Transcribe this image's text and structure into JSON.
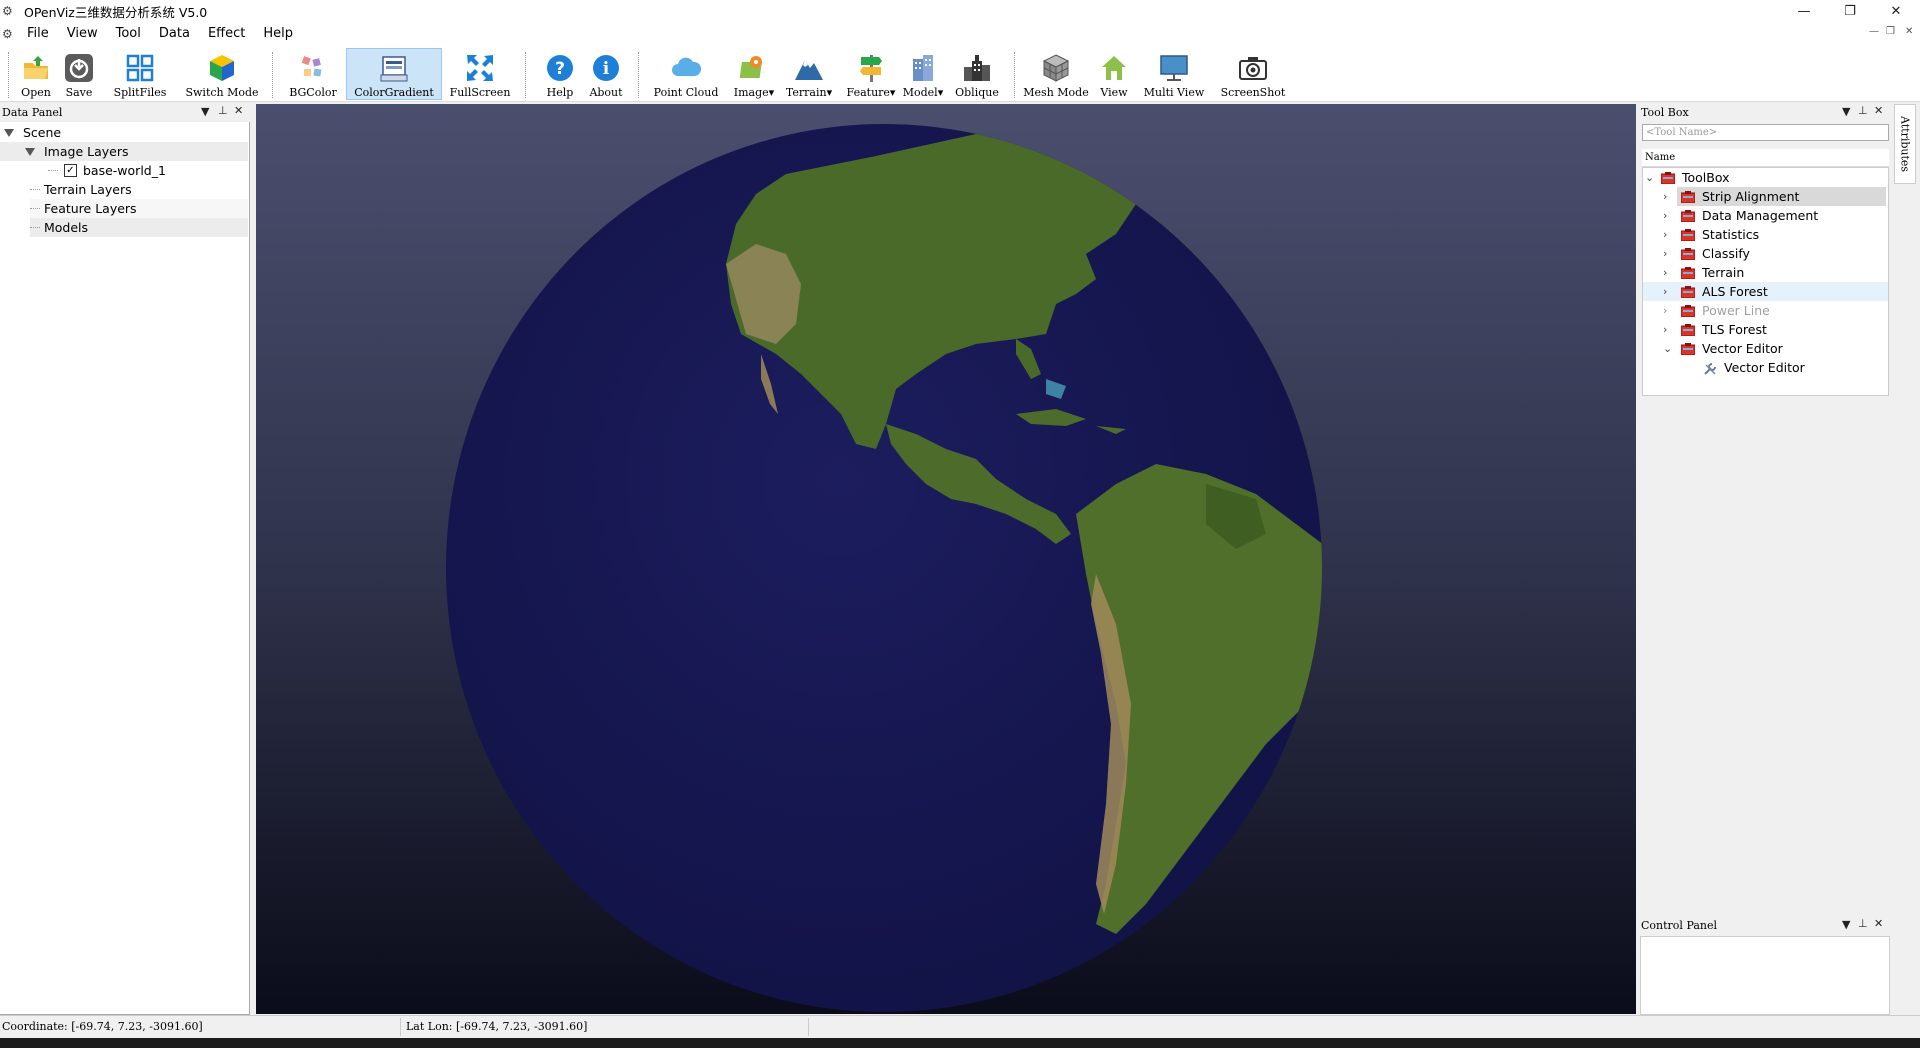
{
  "window": {
    "title": "OPenViz三维数据分析系统 V5.0",
    "minimize": "—",
    "restore": "❐",
    "close": "✕"
  },
  "menu": {
    "items": [
      "File",
      "View",
      "Tool",
      "Data",
      "Effect",
      "Help"
    ]
  },
  "toolbar": {
    "buttons": [
      {
        "label": "Open",
        "icon": "open-folder-icon"
      },
      {
        "label": "Save",
        "icon": "save-icon"
      },
      {
        "label": "SplitFiles",
        "icon": "split-files-icon"
      },
      {
        "label": "Switch Mode",
        "icon": "switch-mode-cube-icon"
      },
      {
        "label": "BGColor",
        "icon": "palette-icon"
      },
      {
        "label": "ColorGradient",
        "icon": "color-gradient-icon",
        "active": true
      },
      {
        "label": "FullScreen",
        "icon": "fullscreen-icon"
      },
      {
        "label": "Help",
        "icon": "help-icon"
      },
      {
        "label": "About",
        "icon": "info-icon"
      },
      {
        "label": "Point Cloud",
        "icon": "cloud-icon"
      },
      {
        "label": "Image",
        "icon": "image-map-icon",
        "dropdown": "▾"
      },
      {
        "label": "Terrain",
        "icon": "mountain-icon",
        "dropdown": "▾"
      },
      {
        "label": "Feature",
        "icon": "signpost-icon",
        "dropdown": "▾"
      },
      {
        "label": "Model",
        "icon": "building-icon",
        "dropdown": "▾"
      },
      {
        "label": "Oblique",
        "icon": "city-icon"
      },
      {
        "label": "Mesh Mode",
        "icon": "mesh-cube-icon"
      },
      {
        "label": "View",
        "icon": "home-icon"
      },
      {
        "label": "Multi View",
        "icon": "monitor-icon"
      },
      {
        "label": "ScreenShot",
        "icon": "camera-icon"
      }
    ]
  },
  "data_panel": {
    "title": "Data Panel",
    "tree": {
      "root": "Scene",
      "image_layers": "Image Layers",
      "layer": "base-world_1",
      "terrain_layers": "Terrain Layers",
      "feature_layers": "Feature Layers",
      "models": "Models"
    }
  },
  "tool_box": {
    "title": "Tool Box",
    "search_placeholder": "<Tool Name>",
    "column_header": "Name",
    "root": "ToolBox",
    "items": [
      {
        "label": "Strip Alignment",
        "state": "selected"
      },
      {
        "label": "Data Management",
        "state": "normal"
      },
      {
        "label": "Statistics",
        "state": "normal"
      },
      {
        "label": "Classify",
        "state": "normal"
      },
      {
        "label": "Terrain",
        "state": "normal"
      },
      {
        "label": "ALS Forest",
        "state": "hover"
      },
      {
        "label": "Power Line",
        "state": "disabled"
      },
      {
        "label": "TLS Forest",
        "state": "normal"
      },
      {
        "label": "Vector Editor",
        "state": "expanded"
      }
    ],
    "child": "Vector Editor"
  },
  "control_panel": {
    "title": "Control Panel"
  },
  "attributes_tab": "Attributes",
  "status": {
    "coordinate": "Coordinate: [-69.74, 7.23, -3091.60]",
    "latlon": "Lat Lon: [-69.74, 7.23, -3091.60]"
  },
  "colors": {
    "accent_active": "#cce4f7",
    "ocean": "#16174f",
    "land_green": "#4a6a2a",
    "selected_row": "#d9d9d9",
    "hover_row": "#e5f1fb"
  }
}
